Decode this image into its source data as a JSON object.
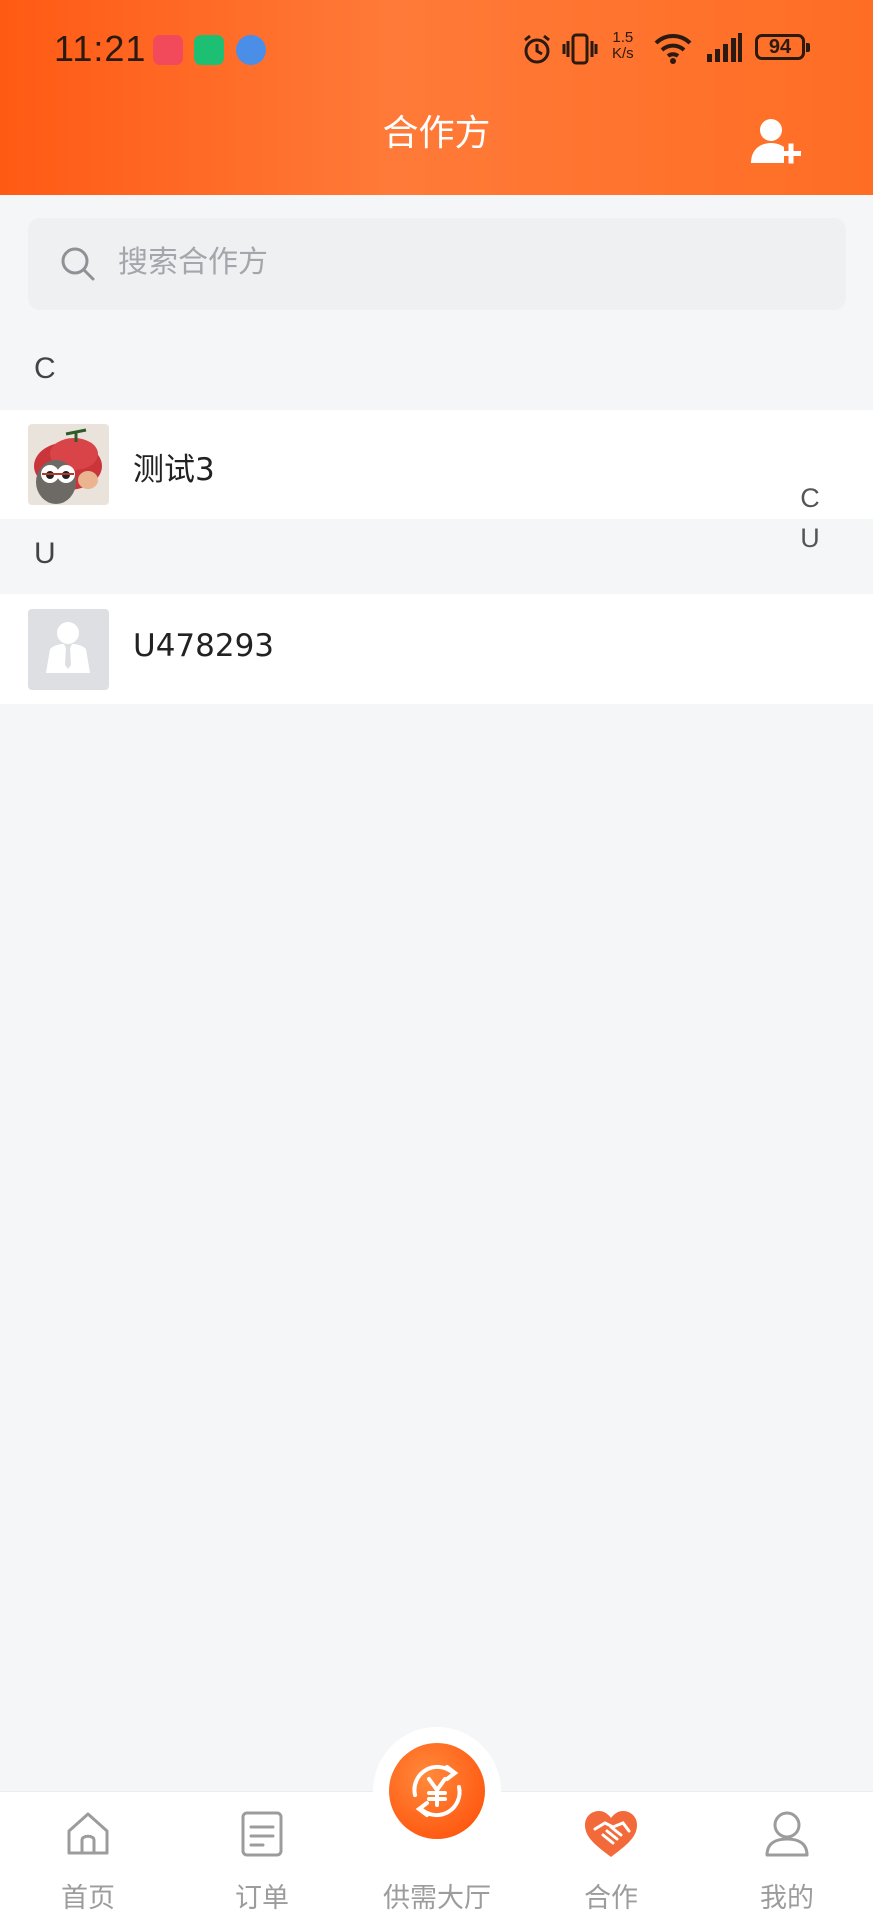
{
  "status_bar": {
    "time": "11:21",
    "net_speed_value": "1.5",
    "net_speed_unit": "K/s",
    "battery": "94"
  },
  "header": {
    "title": "合作方",
    "add_icon": "add-user-icon"
  },
  "search": {
    "placeholder": "搜索合作方",
    "icon": "search-icon"
  },
  "sections": [
    {
      "letter": "C",
      "items": [
        {
          "name": "测试3",
          "avatar": "photo"
        }
      ]
    },
    {
      "letter": "U",
      "items": [
        {
          "name": "U478293",
          "avatar": "default-person"
        }
      ]
    }
  ],
  "index_bar": [
    "C",
    "U"
  ],
  "tabbar": {
    "tabs": [
      {
        "label": "首页",
        "icon": "home-icon",
        "active": false
      },
      {
        "label": "订单",
        "icon": "order-icon",
        "active": false
      },
      {
        "label": "供需大厅",
        "icon": "yuan-exchange-icon",
        "active": false
      },
      {
        "label": "合作",
        "icon": "handshake-heart-icon",
        "active": true
      },
      {
        "label": "我的",
        "icon": "user-icon",
        "active": false
      }
    ]
  },
  "colors": {
    "accent": "#f2691e",
    "header_start": "#ff5a14",
    "header_end": "#ff7a38"
  }
}
